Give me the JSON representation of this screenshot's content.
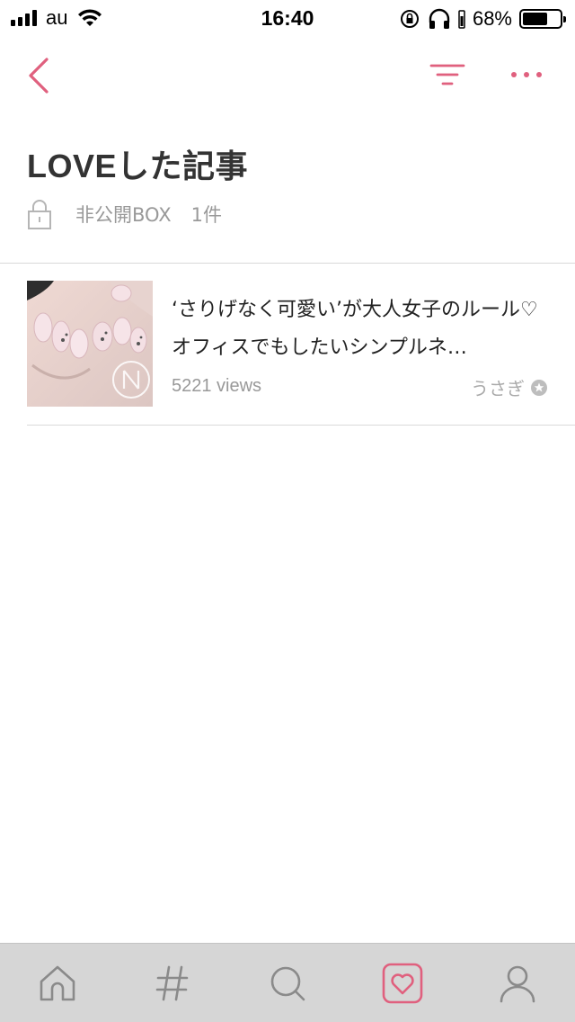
{
  "status_bar": {
    "carrier": "au",
    "time": "16:40",
    "battery_percent": "68%",
    "battery_level": 0.68
  },
  "nav": {
    "back_icon": "chevron-left-icon",
    "filter_icon": "filter-icon",
    "more_icon": "more-dots-icon"
  },
  "header": {
    "title": "LOVEした記事",
    "box_label": "非公開BOX",
    "box_count": "1件",
    "lock_icon": "lock-icon"
  },
  "articles": [
    {
      "title": "‘さりげなく可愛い’が大人女子のルール♡オフィスでもしたいシンプルネ…",
      "views": "5221 views",
      "author": "うさぎ"
    }
  ],
  "tab_bar": {
    "items": [
      "home-icon",
      "hashtag-icon",
      "search-icon",
      "love-heart-icon",
      "profile-icon"
    ],
    "active": "love-heart-icon"
  },
  "colors": {
    "accent": "#e0607e",
    "muted": "#999999",
    "tab_bar_bg": "#d6d6d6",
    "tab_icon": "#8a8a8a"
  }
}
